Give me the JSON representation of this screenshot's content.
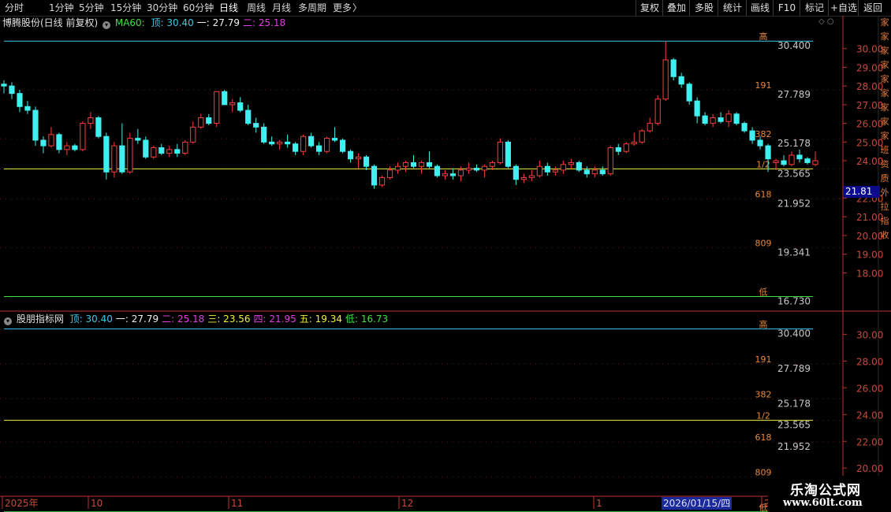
{
  "toolbar": {
    "period_tabs": [
      "分时",
      "1分钟",
      "5分钟",
      "15分钟",
      "30分钟",
      "60分钟",
      "日线",
      "周线",
      "月线",
      "多周期",
      "更多"
    ],
    "active_tab": "日线",
    "more_arrow": "〉",
    "right_buttons": [
      "复权",
      "叠加",
      "多股",
      "统计",
      "画线",
      "F10",
      "标记",
      "+自选",
      "返回"
    ]
  },
  "main_panel": {
    "stock_title": "博腾股份(日线 前复权)",
    "indicator_name": "MA60:",
    "legend": [
      {
        "label": "顶: 30.40",
        "color": "#3ec8e8"
      },
      {
        "label": "一: 27.79",
        "color": "#f0f0f0"
      },
      {
        "label": "二: 25.18",
        "color": "#e040e0"
      }
    ],
    "current_price_tag": "21.81"
  },
  "sub_panel": {
    "indicator_title": "股朋指标网",
    "legend": [
      {
        "label": "顶: 30.40",
        "color": "#3ec8e8"
      },
      {
        "label": "一: 27.79",
        "color": "#f0f0f0"
      },
      {
        "label": "二: 25.18",
        "color": "#e040e0"
      },
      {
        "label": "三: 23.56",
        "color": "#f0f040"
      },
      {
        "label": "四: 21.95",
        "color": "#e040e0"
      },
      {
        "label": "五: 19.34",
        "color": "#f0f040"
      },
      {
        "label": "低: 16.73",
        "color": "#40e040"
      }
    ]
  },
  "colors": {
    "up": "#ff3c3c",
    "down": "#40f0f0",
    "axis": "#c03030",
    "fib_label": "#e8883a",
    "value_label": "#c8c8c8"
  },
  "chart_data": {
    "type": "candlestick",
    "candles": [
      [
        28.1,
        28.3,
        27.6,
        28.0
      ],
      [
        28.0,
        28.2,
        27.3,
        27.6
      ],
      [
        27.6,
        27.8,
        26.6,
        26.9
      ],
      [
        26.9,
        27.2,
        26.5,
        26.7
      ],
      [
        26.7,
        26.9,
        24.8,
        25.1
      ],
      [
        25.1,
        25.3,
        24.4,
        24.8
      ],
      [
        24.8,
        25.8,
        24.7,
        25.4
      ],
      [
        25.4,
        25.5,
        24.4,
        24.6
      ],
      [
        24.6,
        25.0,
        24.3,
        24.8
      ],
      [
        24.8,
        24.9,
        24.5,
        24.6
      ],
      [
        24.6,
        26.1,
        24.5,
        26.0
      ],
      [
        26.0,
        26.6,
        25.7,
        26.3
      ],
      [
        26.3,
        26.4,
        25.2,
        25.3
      ],
      [
        25.3,
        25.5,
        23.0,
        23.4
      ],
      [
        23.4,
        25.0,
        23.1,
        24.8
      ],
      [
        24.8,
        26.0,
        23.3,
        23.4
      ],
      [
        23.4,
        25.5,
        23.3,
        25.2
      ],
      [
        25.2,
        25.7,
        24.9,
        25.1
      ],
      [
        25.1,
        25.3,
        24.1,
        24.2
      ],
      [
        24.2,
        24.8,
        24.1,
        24.7
      ],
      [
        24.7,
        24.9,
        24.3,
        24.4
      ],
      [
        24.4,
        24.8,
        24.2,
        24.6
      ],
      [
        24.6,
        24.9,
        24.2,
        24.4
      ],
      [
        24.4,
        25.1,
        24.3,
        25.0
      ],
      [
        25.0,
        26.1,
        24.9,
        25.8
      ],
      [
        25.8,
        26.5,
        25.7,
        26.3
      ],
      [
        26.3,
        26.5,
        25.9,
        26.0
      ],
      [
        26.0,
        27.7,
        25.8,
        27.7
      ],
      [
        27.7,
        27.8,
        27.0,
        27.0
      ],
      [
        27.0,
        27.3,
        26.6,
        27.1
      ],
      [
        27.1,
        27.4,
        26.6,
        26.7
      ],
      [
        26.7,
        27.0,
        25.9,
        26.0
      ],
      [
        26.0,
        26.3,
        25.5,
        25.8
      ],
      [
        25.8,
        26.0,
        24.9,
        25.0
      ],
      [
        25.0,
        25.3,
        24.8,
        24.9
      ],
      [
        24.9,
        25.1,
        24.6,
        25.0
      ],
      [
        25.0,
        25.4,
        24.7,
        24.9
      ],
      [
        24.9,
        25.0,
        24.3,
        24.5
      ],
      [
        24.5,
        25.4,
        24.3,
        25.3
      ],
      [
        25.3,
        25.5,
        24.7,
        24.8
      ],
      [
        24.8,
        25.0,
        24.3,
        24.5
      ],
      [
        24.5,
        25.3,
        24.4,
        25.2
      ],
      [
        25.2,
        25.8,
        25.0,
        25.1
      ],
      [
        25.1,
        25.2,
        24.4,
        24.5
      ],
      [
        24.5,
        24.6,
        23.9,
        24.1
      ],
      [
        24.1,
        24.4,
        23.6,
        24.2
      ],
      [
        24.2,
        24.3,
        23.5,
        23.7
      ],
      [
        23.7,
        23.8,
        22.5,
        22.7
      ],
      [
        22.7,
        23.2,
        22.6,
        23.1
      ],
      [
        23.1,
        23.7,
        23.0,
        23.5
      ],
      [
        23.5,
        23.9,
        23.3,
        23.7
      ],
      [
        23.7,
        24.0,
        23.4,
        23.9
      ],
      [
        23.9,
        24.3,
        23.6,
        23.7
      ],
      [
        23.7,
        24.0,
        23.3,
        23.9
      ],
      [
        23.9,
        24.5,
        23.6,
        23.7
      ],
      [
        23.7,
        23.8,
        23.1,
        23.2
      ],
      [
        23.2,
        23.5,
        23.0,
        23.3
      ],
      [
        23.3,
        23.6,
        23.0,
        23.2
      ],
      [
        23.2,
        23.7,
        22.9,
        23.5
      ],
      [
        23.5,
        23.9,
        23.3,
        23.6
      ],
      [
        23.6,
        23.8,
        23.4,
        23.5
      ],
      [
        23.5,
        23.8,
        23.1,
        23.7
      ],
      [
        23.7,
        24.0,
        23.5,
        23.9
      ],
      [
        23.9,
        25.2,
        23.8,
        25.0
      ],
      [
        25.0,
        25.1,
        23.6,
        23.7
      ],
      [
        23.7,
        23.8,
        22.7,
        23.0
      ],
      [
        23.0,
        23.3,
        22.8,
        23.1
      ],
      [
        23.1,
        23.5,
        22.9,
        23.2
      ],
      [
        23.2,
        24.0,
        23.1,
        23.7
      ],
      [
        23.7,
        23.9,
        23.2,
        23.4
      ],
      [
        23.4,
        23.7,
        23.2,
        23.5
      ],
      [
        23.5,
        24.0,
        23.3,
        23.8
      ],
      [
        23.8,
        24.1,
        23.6,
        23.9
      ],
      [
        23.9,
        24.0,
        23.4,
        23.5
      ],
      [
        23.5,
        23.7,
        23.1,
        23.3
      ],
      [
        23.3,
        23.7,
        23.1,
        23.5
      ],
      [
        23.5,
        23.7,
        23.2,
        23.3
      ],
      [
        23.3,
        24.8,
        23.2,
        24.7
      ],
      [
        24.7,
        24.9,
        24.3,
        24.5
      ],
      [
        24.5,
        25.0,
        24.4,
        24.9
      ],
      [
        24.9,
        25.5,
        24.8,
        25.0
      ],
      [
        25.0,
        25.7,
        24.9,
        25.6
      ],
      [
        25.6,
        26.3,
        25.5,
        26.0
      ],
      [
        26.0,
        27.5,
        25.9,
        27.3
      ],
      [
        27.3,
        30.4,
        27.2,
        29.4
      ],
      [
        29.4,
        29.5,
        28.3,
        28.5
      ],
      [
        28.5,
        28.7,
        27.9,
        28.1
      ],
      [
        28.1,
        28.2,
        27.0,
        27.2
      ],
      [
        27.2,
        27.4,
        26.0,
        26.4
      ],
      [
        26.4,
        26.6,
        25.9,
        26.0
      ],
      [
        26.0,
        26.5,
        25.8,
        26.3
      ],
      [
        26.3,
        26.6,
        26.0,
        26.1
      ],
      [
        26.1,
        26.7,
        25.8,
        26.5
      ],
      [
        26.5,
        26.6,
        25.9,
        26.0
      ],
      [
        26.0,
        26.1,
        25.5,
        25.6
      ],
      [
        25.6,
        25.8,
        24.9,
        25.1
      ],
      [
        25.1,
        25.3,
        24.6,
        24.8
      ],
      [
        24.8,
        24.9,
        23.4,
        24.1
      ],
      [
        23.9,
        24.1,
        23.5,
        24.0
      ],
      [
        24.0,
        24.3,
        23.7,
        23.8
      ],
      [
        23.8,
        24.5,
        23.7,
        24.3
      ],
      [
        24.3,
        24.6,
        23.9,
        24.1
      ],
      [
        24.1,
        24.2,
        23.8,
        23.9
      ],
      [
        23.8,
        24.5,
        23.7,
        24.0
      ]
    ],
    "x_labels": [
      "2025年",
      "10",
      "11",
      "12",
      "1",
      "2026/01/15/四",
      "2"
    ],
    "main_axis": {
      "range": [
        16.5,
        31.0
      ],
      "ticks": [
        "30.00",
        "29.00",
        "28.00",
        "27.00",
        "26.00",
        "25.00",
        "24.00",
        "22.00",
        "21.00",
        "20.00",
        "19.00",
        "18.00"
      ]
    },
    "sub_axis": {
      "range": [
        18.6,
        31.2
      ],
      "ticks": [
        "30.00",
        "28.00",
        "26.00",
        "24.00",
        "22.00",
        "20.00"
      ]
    },
    "fib_levels": [
      {
        "tag": "高",
        "value_label": "30.400",
        "price": 30.4,
        "color": "#3ec8e8"
      },
      {
        "tag": "191",
        "value_label": "27.789",
        "price": 27.789,
        "color": "#f0f0f0"
      },
      {
        "tag": "382",
        "value_label": "25.178",
        "price": 25.178,
        "color": "#e040e0"
      },
      {
        "tag": "1/2",
        "value_label": "23.565",
        "price": 23.565,
        "color": "#f0f040"
      },
      {
        "tag": "618",
        "value_label": "21.952",
        "price": 21.952,
        "color": "#e040e0"
      },
      {
        "tag": "809",
        "value_label": "19.341",
        "price": 19.341,
        "color": "#f0f040"
      },
      {
        "tag": "低",
        "value_label": "16.730",
        "price": 16.73,
        "color": "#40e040"
      }
    ]
  },
  "right_strip_glyphs": [
    "家",
    "家",
    "家",
    "家",
    "家",
    "家",
    "家",
    "家",
    "家",
    "班",
    "资",
    "质",
    "外",
    "拉",
    "指",
    "收"
  ],
  "watermark": {
    "title": "乐淘公式网",
    "url": "www.60lt.com"
  }
}
